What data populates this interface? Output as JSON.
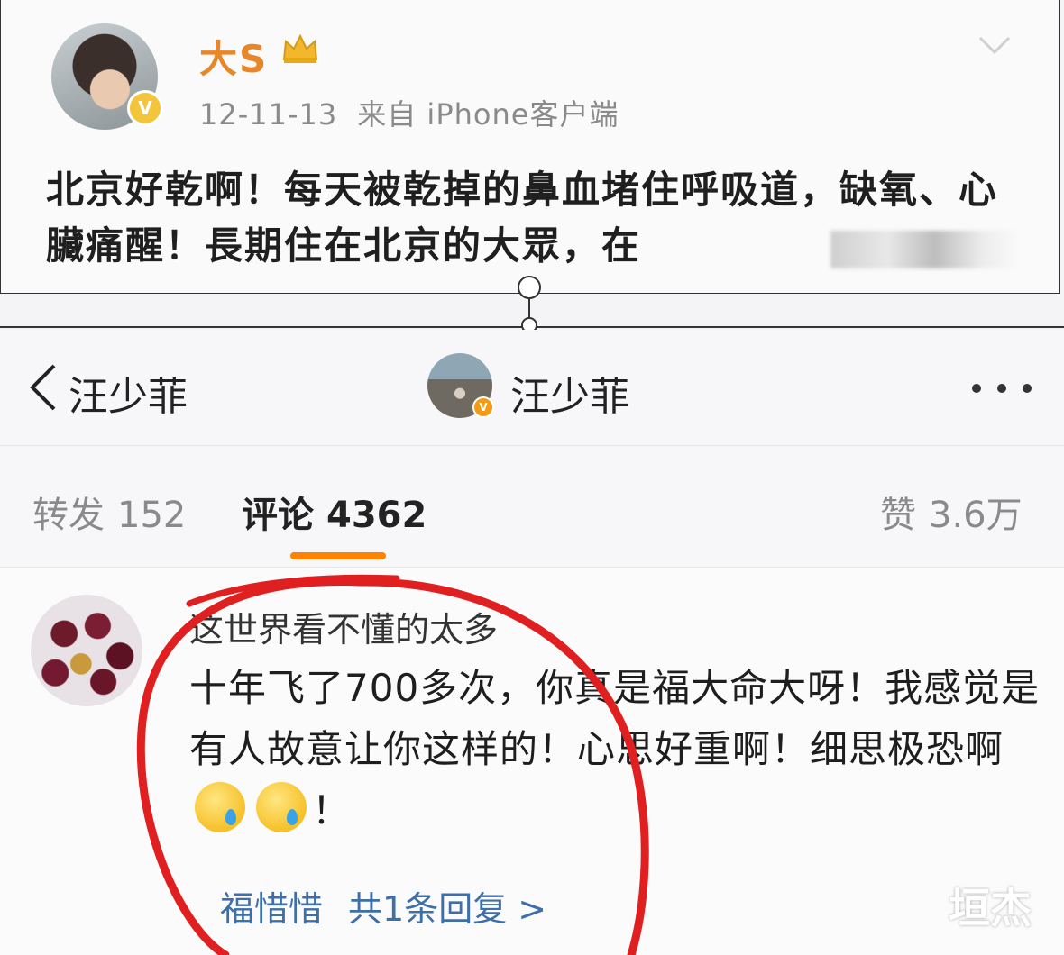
{
  "post": {
    "author": "大S",
    "date": "12-11-13",
    "source": "来自 iPhone客户端",
    "text": "北京好乾啊！每天被乾掉的鼻血堵住呼吸道，缺氧、心臟痛醒！長期住在北京的大眾，在",
    "badge_icon": "crown-icon"
  },
  "nav": {
    "back_label": "汪少菲",
    "title": "汪少菲",
    "more_icon": "more-dots-icon"
  },
  "tabs": {
    "repost_label": "转发",
    "repost_count": "152",
    "comments_label": "评论",
    "comments_count": "4362",
    "likes_label": "赞",
    "likes_count": "3.6万",
    "active_color": "#ff8200"
  },
  "comment": {
    "user": "这世界看不懂的太多",
    "text_part1": "十年飞了700多次，你真是福大命大呀！我感觉是有人故意让你这样的！心思好重啊！细思极恐啊",
    "text_end": "！",
    "emoji_name": "sweat-emoji",
    "reply_user": "福惜惜",
    "reply_count": "共1条回复 >"
  },
  "watermark": "垣杰",
  "colors": {
    "author_orange": "#e8872a",
    "link_blue": "#3e6fa8",
    "annotation_red": "#e02020"
  }
}
